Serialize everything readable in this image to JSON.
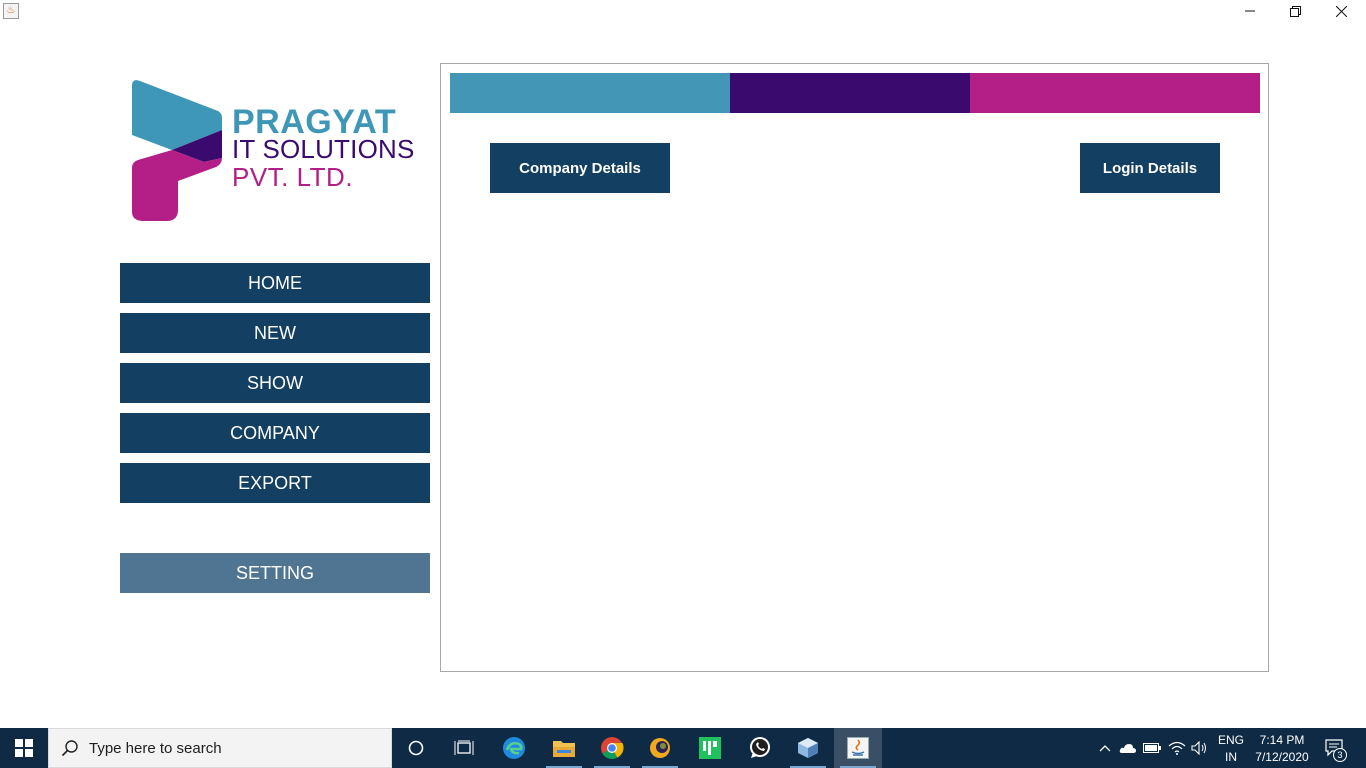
{
  "window": {
    "app_icon": "java-icon",
    "controls": [
      "minimize-icon",
      "restore-icon",
      "close-icon"
    ]
  },
  "logo": {
    "line1": "PRAGYAT",
    "line2": "IT SOLUTIONS",
    "line3": "PVT. LTD.",
    "colors": {
      "teal": "#3f97b8",
      "purple": "#3a0a6e",
      "magenta": "#b31f86"
    }
  },
  "sidebar": {
    "items": [
      {
        "label": "HOME"
      },
      {
        "label": "NEW"
      },
      {
        "label": "SHOW"
      },
      {
        "label": "COMPANY"
      },
      {
        "label": "EXPORT"
      }
    ],
    "setting_label": "SETTING",
    "colors": {
      "button": "#123f62",
      "setting": "#4f7592"
    }
  },
  "main": {
    "bands": [
      "#4396b6",
      "#3b0a6f",
      "#b31f86"
    ],
    "company_details_label": "Company Details",
    "login_details_label": "Login Details"
  },
  "taskbar": {
    "search_placeholder": "Type here to search",
    "apps": [
      "cortana-icon",
      "task-view-icon",
      "edge-icon",
      "file-explorer-icon",
      "chrome-icon",
      "eclipse-icon",
      "intellij-icon",
      "whatsapp-icon",
      "virtualbox-icon",
      "java-app-icon"
    ],
    "language": "ENG",
    "region": "IN",
    "time": "7:14 PM",
    "date": "7/12/2020",
    "notification_count": "3"
  }
}
